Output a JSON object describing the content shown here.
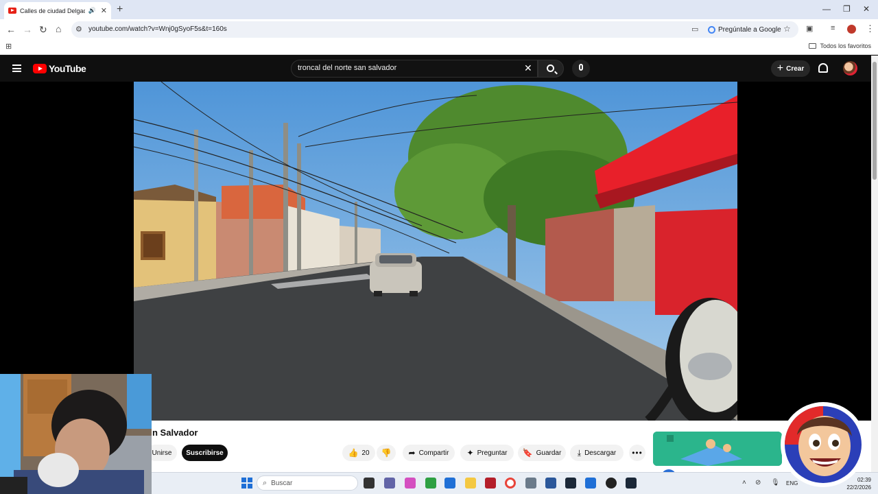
{
  "browser": {
    "tab_title": "Calles de ciudad Delgado S",
    "url": "youtube.com/watch?v=Wnj0gSyoF5s&t=160s",
    "ask_google": "Pregúntale a Google",
    "bookmarks_all": "Todos los favoritos"
  },
  "youtube": {
    "logo": "YouTube",
    "search_query": "troncal del norte san salvador",
    "create_label": "Crear"
  },
  "video": {
    "title_partial": "n Salvador",
    "join_label": "Unirse",
    "subscribe_label": "Suscribirse",
    "like_count": "20",
    "share_label": "Compartir",
    "ask_label": "Preguntar",
    "save_label": "Guardar",
    "download_label": "Descargar"
  },
  "taskbar": {
    "search_placeholder": "Buscar",
    "language": "ENG",
    "time": "02:39",
    "date": "22/2/2026"
  },
  "colors": {
    "youtube_red": "#ff0000",
    "header_bg": "#0f0f0f",
    "subscribe_bg": "#0f0f0f"
  }
}
